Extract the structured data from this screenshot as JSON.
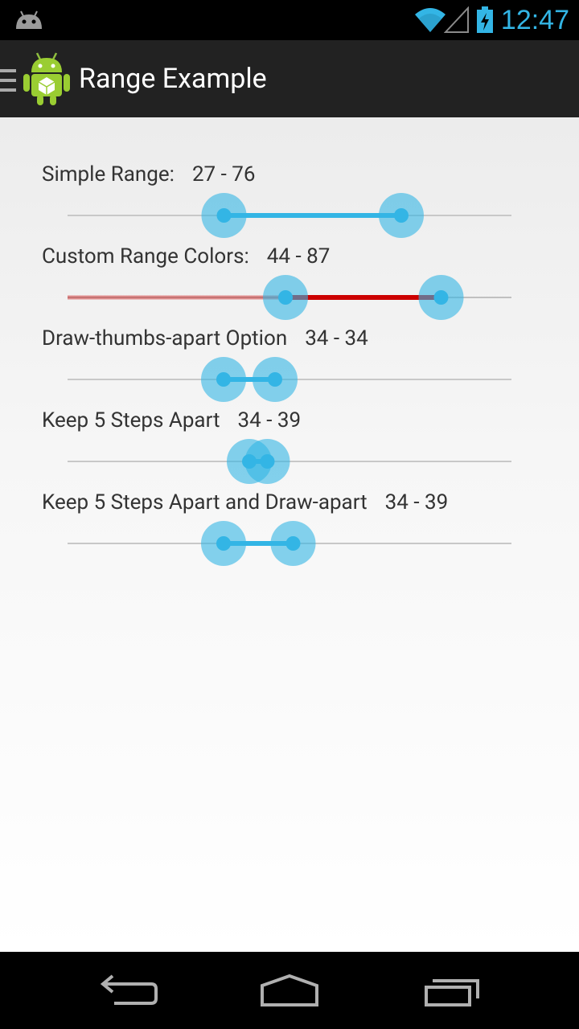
{
  "status_bar": {
    "time": "12:47",
    "icons": [
      "android-notification-icon",
      "wifi-icon",
      "signal-icon",
      "battery-charging-icon"
    ],
    "accent_color": "#33b5e5"
  },
  "action_bar": {
    "title": "Range Example",
    "icons": [
      "menu-icon",
      "android-app-icon"
    ]
  },
  "rows": [
    {
      "label": "Simple Range:",
      "value_text": "27 - 76",
      "min": 27,
      "max": 76,
      "style": "default"
    },
    {
      "label": "Custom Range Colors:",
      "value_text": "44 - 87",
      "min": 44,
      "max": 87,
      "style": "custom"
    },
    {
      "label": "Draw-thumbs-apart Option",
      "value_text": "34 - 34",
      "min": 34,
      "max": 34,
      "style": "apart"
    },
    {
      "label": "Keep 5 Steps Apart",
      "value_text": "34 - 39",
      "min": 34,
      "max": 39,
      "style": "default"
    },
    {
      "label": "Keep 5 Steps Apart and Draw-apart",
      "value_text": "34 - 39",
      "min": 34,
      "max": 39,
      "style": "apart"
    }
  ],
  "colors": {
    "accent": "#33b5e5",
    "custom_range": "#cc0000",
    "track": "#c8c8c8"
  },
  "nav_bar": {
    "icons": [
      "back-icon",
      "home-icon",
      "recent-apps-icon"
    ]
  }
}
